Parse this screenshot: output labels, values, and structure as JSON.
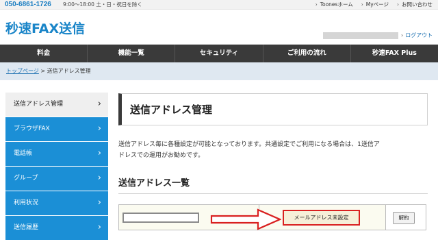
{
  "topbar": {
    "phone": "050-6861-1726",
    "hours": "9:00～18:00 土・日・祝日を除く",
    "links": [
      "Toonesホーム",
      "Myページ",
      "お問い合わせ"
    ]
  },
  "header": {
    "logo": "秒速FAX送信",
    "logout": "ログアウト"
  },
  "nav": {
    "items": [
      "料金",
      "機能一覧",
      "セキュリティ",
      "ご利用の流れ",
      "秒速FAX Plus"
    ]
  },
  "breadcrumb": {
    "home": "トップページ",
    "separator": ">",
    "current": "送信アドレス管理"
  },
  "sidebar": {
    "items": [
      {
        "label": "送信アドレス管理"
      },
      {
        "label": "ブラウザFAX"
      },
      {
        "label": "電話帳"
      },
      {
        "label": "グループ"
      },
      {
        "label": "利用状況"
      },
      {
        "label": "送信履歴"
      }
    ],
    "active_index": 0
  },
  "main": {
    "title": "送信アドレス管理",
    "description_line1": "送信アドレス毎に各種設定が可能となっております。共通設定でご利用になる場合は、1送信ア",
    "description_line2": "ドレスでの運用がお勧めです。",
    "list_heading": "送信アドレス一覧",
    "row": {
      "set_button": "メールアドレス未設定",
      "cancel_button": "解約"
    }
  },
  "colors": {
    "brand_blue": "#1a85c8",
    "sidebar_blue": "#1b8fd6",
    "nav_dark": "#3a3a3a",
    "highlight_red": "#d92020"
  },
  "icons": {
    "sidebar_chevron": "chevron-right-icon",
    "annotation": "red-arrow-icon"
  }
}
